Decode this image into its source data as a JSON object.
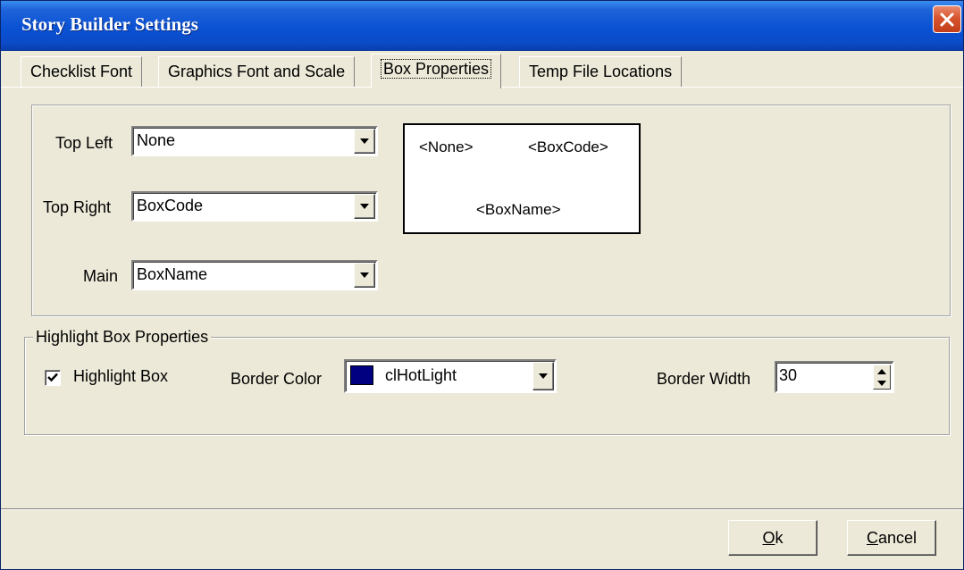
{
  "window": {
    "title": "Story Builder Settings"
  },
  "tabs": [
    {
      "label": "Checklist Font",
      "active": false
    },
    {
      "label": "Graphics Font and Scale",
      "active": false
    },
    {
      "label": "Box Properties",
      "active": true
    },
    {
      "label": "Temp File Locations",
      "active": false
    }
  ],
  "box_properties": {
    "top_left": {
      "label": "Top Left",
      "value": "None"
    },
    "top_right": {
      "label": "Top Right",
      "value": "BoxCode"
    },
    "main": {
      "label": "Main",
      "value": "BoxName"
    },
    "preview": {
      "top_left": "<None>",
      "top_right": "<BoxCode>",
      "main": "<BoxName>"
    }
  },
  "highlight": {
    "group_label": "Highlight Box Properties",
    "checkbox_label": "Highlight Box",
    "checked": true,
    "border_color_label": "Border Color",
    "border_color_value": "clHotLight",
    "border_color_swatch": "#000080",
    "border_width_label": "Border Width",
    "border_width_value": "30"
  },
  "buttons": {
    "ok_mnemonic": "O",
    "ok_rest": "k",
    "cancel_mnemonic": "C",
    "cancel_rest": "ancel"
  },
  "icons": {
    "close": "close-icon",
    "dropdown": "chevron-down-icon",
    "spin": "spin-updown-icon",
    "check": "check-icon"
  }
}
